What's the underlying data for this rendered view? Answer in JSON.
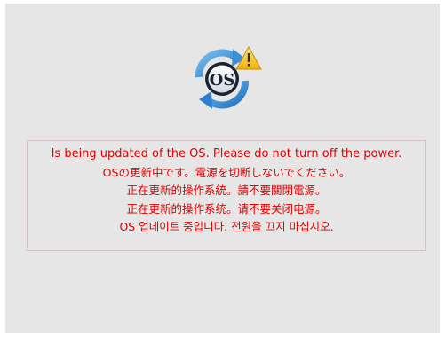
{
  "screen": {
    "background_color": "#e6e6e6",
    "logo": {
      "text": "OS",
      "icon": "os-update-icon",
      "warning_icon": "warning-triangle-icon"
    },
    "message": {
      "color": "#e00000",
      "lines": {
        "en": "Is being updated of the OS. Please do not turn off the power.",
        "ja": "OSの更新中です。電源を切断しないでください。",
        "zh_tw": "正在更新的操作系統。請不要關閉電源。",
        "zh_cn": "正在更新的操作系统。请不要关闭电源。",
        "ko": "OS 업데이트 중입니다. 전원을 끄지 마십시오."
      }
    }
  }
}
